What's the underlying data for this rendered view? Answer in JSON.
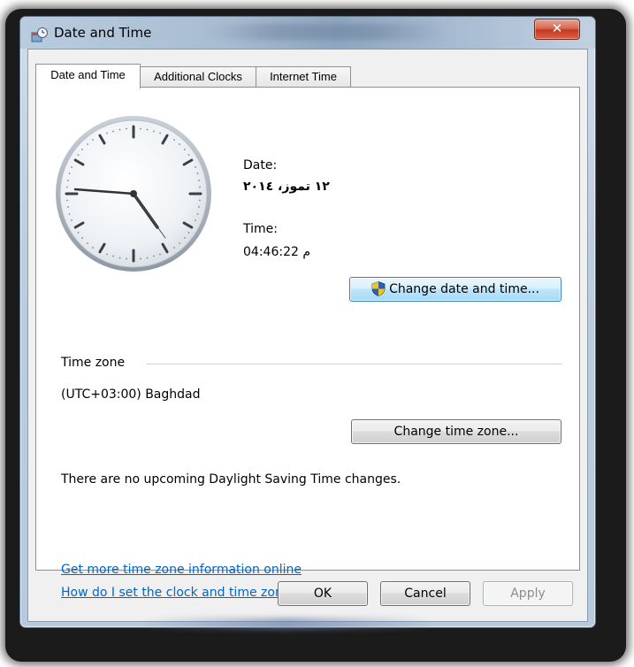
{
  "window": {
    "title": "Date and Time",
    "close_symbol": "✕"
  },
  "tabs": [
    {
      "label": "Date and Time",
      "active": true
    },
    {
      "label": "Additional Clocks",
      "active": false
    },
    {
      "label": "Internet Time",
      "active": false
    }
  ],
  "date_section": {
    "date_label": "Date:",
    "date_value": "١٢ تموز، ٢٠١٤",
    "time_label": "Time:",
    "time_value": "04:46:22 م",
    "change_button": "Change date and time..."
  },
  "timezone": {
    "heading": "Time zone",
    "value": "(UTC+03:00) Baghdad",
    "change_button": "Change time zone..."
  },
  "dst_message": "There are no upcoming Daylight Saving Time changes.",
  "links": {
    "more_info": "Get more time zone information online",
    "how_to": "How do I set the clock and time zone?"
  },
  "footer": {
    "ok": "OK",
    "cancel": "Cancel",
    "apply": "Apply"
  },
  "icons": {
    "window": "date-time-icon",
    "shield": "uac-shield-icon",
    "clock": "analog-clock"
  },
  "colors": {
    "link": "#0066cc",
    "close_button": "#c4391f",
    "focus_border": "#3c7fb1"
  }
}
